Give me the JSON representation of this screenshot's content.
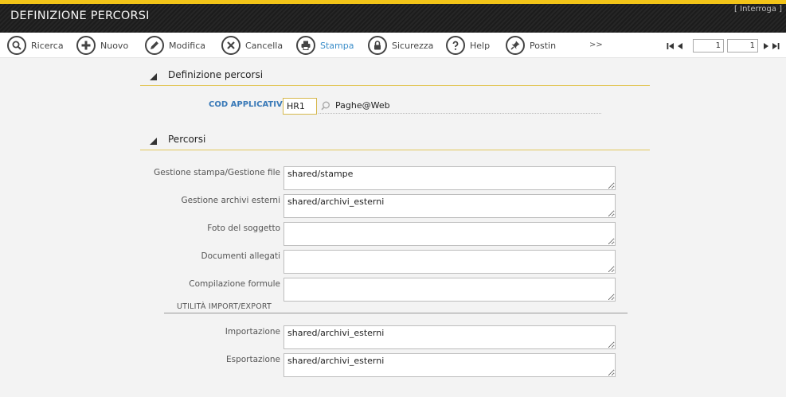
{
  "title": "DEFINIZIONE PERCORSI",
  "mode": "[ Interroga ]",
  "toolbar": {
    "buttons": [
      {
        "label": "Ricerca",
        "icon": "search-icon"
      },
      {
        "label": "Nuovo",
        "icon": "plus-icon"
      },
      {
        "label": "Modifica",
        "icon": "pencil-icon"
      },
      {
        "label": "Cancella",
        "icon": "close-icon"
      },
      {
        "label": "Stampa",
        "icon": "printer-icon"
      },
      {
        "label": "Sicurezza",
        "icon": "lock-icon"
      },
      {
        "label": "Help",
        "icon": "help-icon"
      },
      {
        "label": "Postin",
        "icon": "pin-icon"
      }
    ],
    "more": ">>",
    "active_color": "#3a8dc9"
  },
  "pager": {
    "current": "1",
    "total": "1"
  },
  "section1": {
    "title": "Definizione percorsi",
    "cod_label": "COD APPLICATIVO",
    "cod_value": "HR1",
    "cod_desc": "Paghe@Web"
  },
  "section2": {
    "title": "Percorsi",
    "fields": [
      {
        "label": "Gestione stampa/Gestione file",
        "value": "shared/stampe"
      },
      {
        "label": "Gestione archivi esterni",
        "value": "shared/archivi_esterni"
      },
      {
        "label": "Foto del soggetto",
        "value": ""
      },
      {
        "label": "Documenti allegati",
        "value": ""
      },
      {
        "label": "Compilazione formule",
        "value": ""
      }
    ],
    "subsection": "UTILITÀ IMPORT/EXPORT",
    "fields2": [
      {
        "label": "Importazione",
        "value": "shared/archivi_esterni"
      },
      {
        "label": "Esportazione",
        "value": "shared/archivi_esterni"
      }
    ]
  },
  "colors": {
    "accent": "#f2c418",
    "label_blue": "#3a7ab8"
  }
}
